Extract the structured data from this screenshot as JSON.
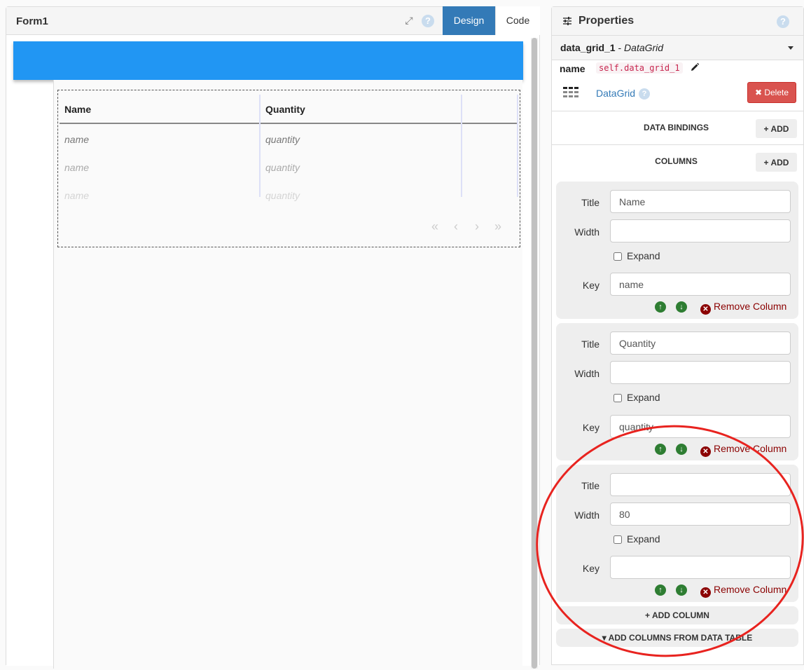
{
  "form_panel": {
    "title": "Form1",
    "expand_icon": "expand-arrows-icon",
    "help_icon": "?",
    "tabs": [
      {
        "label": "Design",
        "active": true
      },
      {
        "label": "Code",
        "active": false
      }
    ],
    "header_bar_color": "#2196f3",
    "datagrid": {
      "columns": [
        "Name",
        "Quantity",
        ""
      ],
      "rows": [
        [
          "name",
          "quantity"
        ],
        [
          "name",
          "quantity"
        ],
        [
          "name",
          "quantity"
        ]
      ],
      "pager": [
        "«",
        "‹",
        "›",
        "»"
      ]
    }
  },
  "properties": {
    "title": "Properties",
    "help_icon": "?",
    "component": {
      "name": "data_grid_1",
      "separator": " - ",
      "type": "DataGrid"
    },
    "name_label": "name",
    "name_value": "self.data_grid_1",
    "type_link": "DataGrid",
    "delete_label": "✖ Delete",
    "sections": {
      "data_bindings": {
        "title": "DATA BINDINGS",
        "add_label": "+ ADD"
      },
      "columns": {
        "title": "COLUMNS",
        "add_label": "+ ADD"
      }
    },
    "field_labels": {
      "title": "Title",
      "width": "Width",
      "expand": "Expand",
      "key": "Key"
    },
    "remove_label": "Remove Column",
    "columns": [
      {
        "title": "Name",
        "width": "",
        "expand": false,
        "key": "name"
      },
      {
        "title": "Quantity",
        "width": "",
        "expand": false,
        "key": "quantity"
      },
      {
        "title": "",
        "width": "80",
        "expand": false,
        "key": ""
      }
    ],
    "add_column_label": "+ ADD COLUMN",
    "add_from_table_label": "▾ ADD COLUMNS FROM DATA TABLE"
  },
  "colors": {
    "accent": "#337ab7",
    "delete": "#d9534f",
    "move_arrows": "#2e7d32",
    "remove": "#8b0000",
    "annotation": "#e8231f"
  }
}
